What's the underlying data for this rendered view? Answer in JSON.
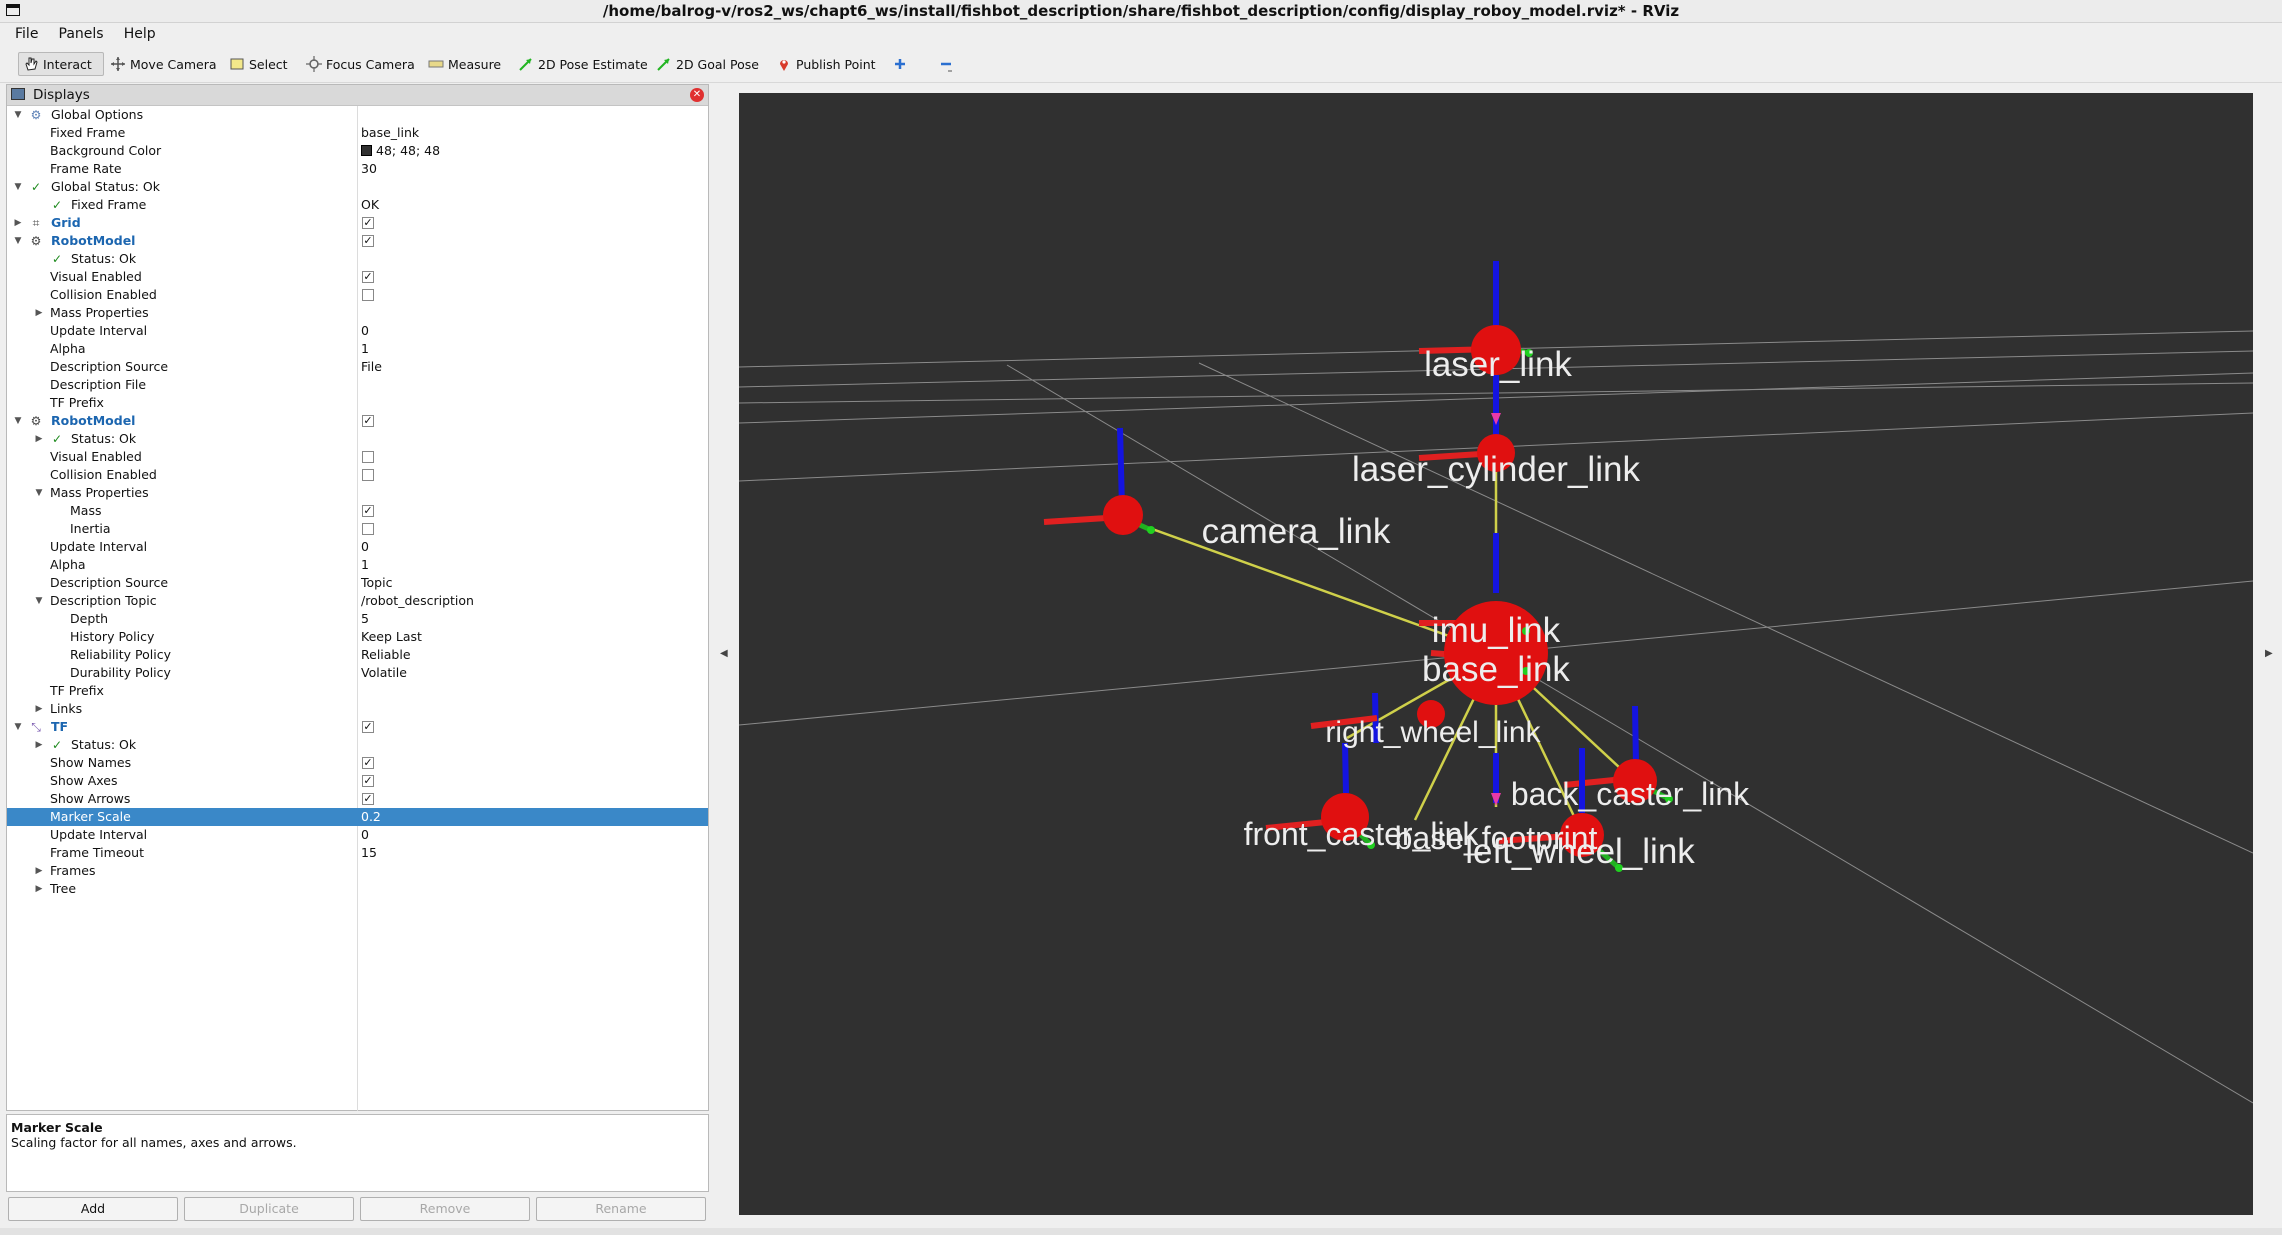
{
  "window": {
    "title": "/home/balrog-v/ros2_ws/chapt6_ws/install/fishbot_description/share/fishbot_description/config/display_roboy_model.rviz* - RViz"
  },
  "menu": [
    "File",
    "Panels",
    "Help"
  ],
  "toolbar": {
    "interact": "Interact",
    "move_camera": "Move Camera",
    "select": "Select",
    "focus_camera": "Focus Camera",
    "measure": "Measure",
    "pose_estimate": "2D Pose Estimate",
    "goal_pose": "2D Goal Pose",
    "publish_point": "Publish Point"
  },
  "displays": {
    "title": "Displays",
    "rows": [
      {
        "label": "Global Options",
        "value": "",
        "arrow": "open",
        "icon": "gear",
        "blue": false,
        "check": false
      },
      {
        "label": "Fixed Frame",
        "value": "base_link"
      },
      {
        "label": "Background Color",
        "value": "48; 48; 48"
      },
      {
        "label": "Frame Rate",
        "value": "30"
      },
      {
        "label": "Global Status: Ok",
        "value": ""
      },
      {
        "label": "Fixed Frame",
        "value": "OK"
      },
      {
        "label": "Grid",
        "value": ""
      },
      {
        "label": "RobotModel",
        "value": ""
      },
      {
        "label": "Status: Ok",
        "value": ""
      },
      {
        "label": "Visual Enabled",
        "value": ""
      },
      {
        "label": "Collision Enabled",
        "value": ""
      },
      {
        "label": "Mass Properties",
        "value": ""
      },
      {
        "label": "Update Interval",
        "value": "0"
      },
      {
        "label": "Alpha",
        "value": "1"
      },
      {
        "label": "Description Source",
        "value": "File"
      },
      {
        "label": "Description File",
        "value": ""
      },
      {
        "label": "TF Prefix",
        "value": ""
      },
      {
        "label": "RobotModel",
        "value": ""
      },
      {
        "label": "Status: Ok",
        "value": ""
      },
      {
        "label": "Visual Enabled",
        "value": ""
      },
      {
        "label": "Collision Enabled",
        "value": ""
      },
      {
        "label": "Mass Properties",
        "value": ""
      },
      {
        "label": "Mass",
        "value": ""
      },
      {
        "label": "Inertia",
        "value": ""
      },
      {
        "label": "Update Interval",
        "value": "0"
      },
      {
        "label": "Alpha",
        "value": "1"
      },
      {
        "label": "Description Source",
        "value": "Topic"
      },
      {
        "label": "Description Topic",
        "value": "/robot_description"
      },
      {
        "label": "Depth",
        "value": "5"
      },
      {
        "label": "History Policy",
        "value": "Keep Last"
      },
      {
        "label": "Reliability Policy",
        "value": "Reliable"
      },
      {
        "label": "Durability Policy",
        "value": "Volatile"
      },
      {
        "label": "TF Prefix",
        "value": ""
      },
      {
        "label": "Links",
        "value": ""
      },
      {
        "label": "TF",
        "value": ""
      },
      {
        "label": "Status: Ok",
        "value": ""
      },
      {
        "label": "Show Names",
        "value": ""
      },
      {
        "label": "Show Axes",
        "value": ""
      },
      {
        "label": "Show Arrows",
        "value": ""
      },
      {
        "label": "Marker Scale",
        "value": "0.2"
      },
      {
        "label": "Update Interval",
        "value": "0"
      },
      {
        "label": "Frame Timeout",
        "value": "15"
      },
      {
        "label": "Frames",
        "value": ""
      },
      {
        "label": "Tree",
        "value": ""
      }
    ]
  },
  "description": {
    "title": "Marker Scale",
    "text": "Scaling factor for all names, axes and arrows."
  },
  "buttons": {
    "add": "Add",
    "duplicate": "Duplicate",
    "remove": "Remove",
    "rename": "Rename"
  },
  "scene": {
    "background": "#303030",
    "labels": {
      "laser": "laser_link",
      "laser_cyl": "laser_cylinder_link",
      "camera": "camera_link",
      "imu": "imu_link",
      "base": "base_link",
      "right_wheel": "right_wheel_link",
      "back_caster": "back_caster_link",
      "front_caster": "front_caster_link",
      "base_footprint": "base_footprint",
      "left_wheel": "left_wheel_link"
    }
  }
}
